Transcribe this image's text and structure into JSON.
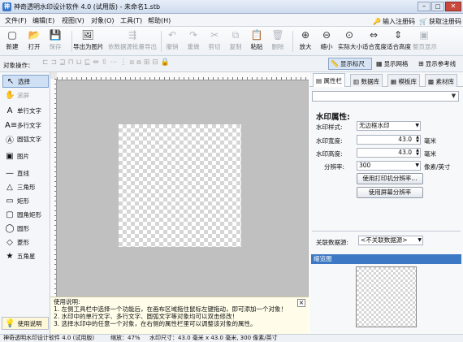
{
  "window": {
    "app_icon": "神",
    "title": "神奇透明水印设计软件 4.0 (试用版) - 未命名1.stb",
    "register_label": "输入注册码",
    "get_code_label": "获取注册码"
  },
  "menu": [
    "文件(F)",
    "编辑(E)",
    "视图(V)",
    "对象(O)",
    "工具(T)",
    "帮助(H)"
  ],
  "toolbar": [
    {
      "label": "新建",
      "icon": "new-icon",
      "glyph": "▢",
      "disabled": false
    },
    {
      "label": "打开",
      "icon": "open-icon",
      "glyph": "📂",
      "disabled": false
    },
    {
      "label": "保存",
      "icon": "save-icon",
      "glyph": "💾",
      "disabled": true
    },
    {
      "label": "导出为图片",
      "icon": "export-image-icon",
      "glyph": "🖼",
      "disabled": false
    },
    {
      "label": "依数据源批量导出",
      "icon": "batch-export-icon",
      "glyph": "⇶",
      "disabled": true
    },
    {
      "label": "撤销",
      "icon": "undo-icon",
      "glyph": "↶",
      "disabled": true
    },
    {
      "label": "重做",
      "icon": "redo-icon",
      "glyph": "↷",
      "disabled": true
    },
    {
      "label": "剪切",
      "icon": "cut-icon",
      "glyph": "✂",
      "disabled": true
    },
    {
      "label": "复制",
      "icon": "copy-icon",
      "glyph": "⧉",
      "disabled": true
    },
    {
      "label": "粘贴",
      "icon": "paste-icon",
      "glyph": "📋",
      "disabled": false
    },
    {
      "label": "删除",
      "icon": "delete-icon",
      "glyph": "🗑",
      "disabled": true
    },
    {
      "label": "放大",
      "icon": "zoom-in-icon",
      "glyph": "⊕",
      "disabled": false
    },
    {
      "label": "缩小",
      "icon": "zoom-out-icon",
      "glyph": "⊖",
      "disabled": false
    },
    {
      "label": "实际大小",
      "icon": "actual-size-icon",
      "glyph": "⊙",
      "disabled": false
    },
    {
      "label": "适合宽度",
      "icon": "fit-width-icon",
      "glyph": "⇔",
      "disabled": false
    },
    {
      "label": "适合高度",
      "icon": "fit-height-icon",
      "glyph": "⇕",
      "disabled": false
    },
    {
      "label": "整页显示",
      "icon": "full-page-icon",
      "glyph": "▣",
      "disabled": true
    }
  ],
  "propbar": {
    "label": "对象操作：",
    "show_ruler": "显示标尺",
    "show_grid": "显示网格",
    "show_guides": "显示参考线"
  },
  "tools": [
    {
      "label": "选择",
      "icon": "select-arrow-icon",
      "glyph": "↖"
    },
    {
      "label": "滚屏",
      "icon": "hand-icon",
      "glyph": "✋"
    },
    {
      "label": "单行文字",
      "icon": "single-text-icon",
      "glyph": "A"
    },
    {
      "label": "多行文字",
      "icon": "multi-text-icon",
      "glyph": "A≡"
    },
    {
      "label": "圆弧文字",
      "icon": "arc-text-icon",
      "glyph": "Ⓐ"
    },
    {
      "label": "图片",
      "icon": "picture-icon",
      "glyph": "▣"
    },
    {
      "label": "直线",
      "icon": "line-icon",
      "glyph": "—"
    },
    {
      "label": "三角形",
      "icon": "triangle-icon",
      "glyph": "△"
    },
    {
      "label": "矩形",
      "icon": "rectangle-icon",
      "glyph": "▭"
    },
    {
      "label": "圆角矩形",
      "icon": "rounded-rect-icon",
      "glyph": "▢"
    },
    {
      "label": "圆形",
      "icon": "ellipse-icon",
      "glyph": "◯"
    },
    {
      "label": "菱形",
      "icon": "diamond-icon",
      "glyph": "◇"
    },
    {
      "label": "五角星",
      "icon": "star-icon",
      "glyph": "★"
    }
  ],
  "help_button": "使用说明",
  "help": {
    "title": "使用说明:",
    "lines": [
      "1. 左侧工具栏中选择一个功能后，在画布区域拖住鼠标左键拖动，即可添加一个对象！",
      "2. 水印中的单行文字、多行文字、圆弧文字等对象均可以双击修改！",
      "3. 选择水印中的任意一个对象，在右侧的属性栏里可以调整该对象的属性。"
    ],
    "close": "×"
  },
  "tabs": [
    "属性栏",
    "数据库",
    "模板库",
    "素材库"
  ],
  "properties": {
    "title": "水印属性:",
    "style_label": "水印样式:",
    "style_value": "无边框水印",
    "width_label": "水印宽度:",
    "width_value": "43.0",
    "height_label": "水印高度:",
    "height_value": "43.0",
    "unit_mm": "毫米",
    "dpi_label": "分辨率:",
    "dpi_value": "300",
    "dpi_unit": "像素/英寸",
    "btn_printer": "使用打印机分辨率...",
    "btn_screen": "使用屏幕分辨率",
    "datasource_label": "关联数据源:",
    "datasource_value": "<不关联数据源>"
  },
  "preview": {
    "title": "缩览图"
  },
  "status": {
    "app": "神奇透明水印设计软件 4.0 (试用版)",
    "zoom": "缩放：47%",
    "size": "水印尺寸：43.0 毫米 x 43.0 毫米, 300 像素/英寸"
  }
}
